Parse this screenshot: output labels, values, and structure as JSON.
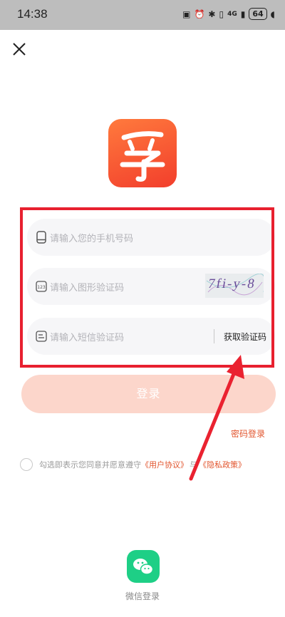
{
  "status_bar": {
    "time": "14:38",
    "network": "4G",
    "battery": "64"
  },
  "colors": {
    "accent": "#e2552e",
    "logo": "#f4502f",
    "highlight_box": "#e8202f",
    "login_disabled": "#fcd6cb",
    "wechat": "#1ecf86"
  },
  "form": {
    "phone": {
      "placeholder": "请输入您的手机号码",
      "icon": "phone-icon"
    },
    "captcha": {
      "placeholder": "请输入图形验证码",
      "icon": "number-123-icon",
      "image_text": "7fi-y-8"
    },
    "sms": {
      "placeholder": "请输入短信验证码",
      "icon": "message-icon",
      "button": "获取验证码"
    }
  },
  "login_button": "登录",
  "password_login": "密码登录",
  "agreement": {
    "prefix": "勾选即表示您同意并愿意遵守",
    "user_agreement": "《用户协议》",
    "and": "与",
    "privacy": "《隐私政策》"
  },
  "wechat": {
    "label": "微信登录",
    "icon": "wechat-icon"
  }
}
